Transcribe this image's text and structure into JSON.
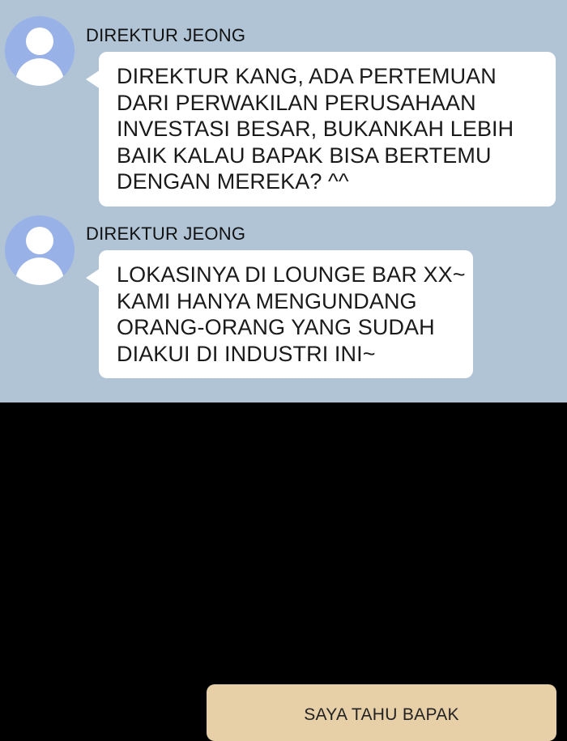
{
  "messages": [
    {
      "sender": "DIREKTUR JEONG",
      "avatar_icon": "user-silhouette-icon",
      "lines": [
        "DIREKTUR KANG, ADA PERTEMUAN",
        "DARI PERWAKILAN PERUSAHAAN",
        "INVESTASI BESAR, BUKANKAH LEBIH",
        "BAIK KALAU BAPAK BISA BERTEMU",
        "DENGAN MEREKA? ^^"
      ]
    },
    {
      "sender": "DIREKTUR JEONG",
      "avatar_icon": "user-silhouette-icon",
      "lines": [
        "LOKASINYA DI LOUNGE BAR XX~",
        "KAMI HANYA MENGUNDANG",
        "ORANG-ORANG YANG SUDAH",
        "DIAKUI DI INDUSTRI INI~"
      ]
    }
  ],
  "reply": {
    "text": "SAYA TAHU BAPAK"
  },
  "colors": {
    "chat_background": "#b0c4d6",
    "avatar": "#98b1e6",
    "bubble": "#ffffff",
    "reply_bubble": "#e7cfa8",
    "panel_below": "#000000"
  }
}
